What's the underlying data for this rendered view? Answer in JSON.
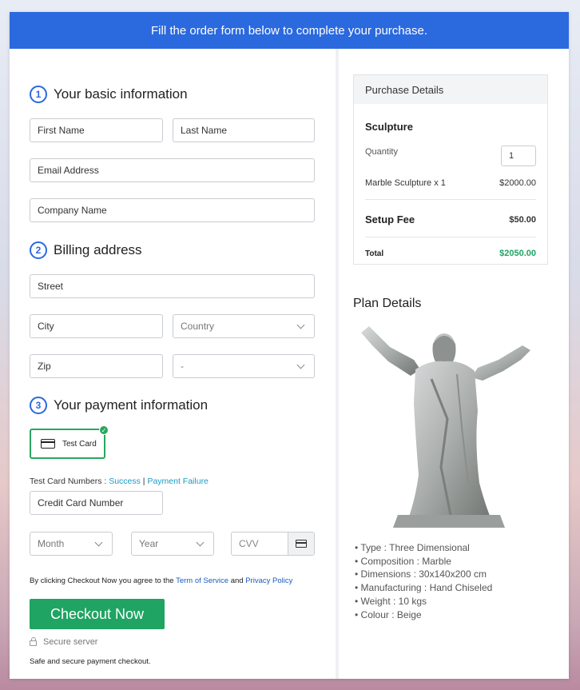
{
  "banner": {
    "text": "Fill the order form below to complete your purchase."
  },
  "basic_info": {
    "step": "1",
    "title": "Your basic information",
    "first_name": "First Name",
    "last_name": "Last Name",
    "email": "Email Address",
    "company": "Company Name"
  },
  "billing": {
    "step": "2",
    "title": "Billing address",
    "street": "Street",
    "city": "City",
    "country": "Country",
    "zip": "Zip",
    "state": "-"
  },
  "payment": {
    "step": "3",
    "title": "Your payment information",
    "card_option": "Test Card",
    "test_numbers_label": "Test Card Numbers : ",
    "success_link": "Success",
    "separator": " | ",
    "failure_link": "Payment Failure",
    "card_number": "Credit Card Number",
    "month": "Month",
    "year": "Year",
    "cvv": "CVV"
  },
  "agreement": {
    "prefix": "By clicking Checkout Now you agree to the ",
    "terms": "Term of Service",
    "and": " and ",
    "privacy": "Privacy Policy"
  },
  "checkout": {
    "button": "Checkout Now",
    "secure": "Secure server",
    "note": "Safe and secure payment checkout."
  },
  "purchase": {
    "header": "Purchase Details",
    "product": "Sculpture",
    "quantity_label": "Quantity",
    "quantity": "1",
    "item": "Marble Sculpture x 1",
    "item_price": "$2000.00",
    "setup_label": "Setup Fee",
    "setup_price": "$50.00",
    "total_label": "Total",
    "total_price": "$2050.00"
  },
  "plan": {
    "title": "Plan Details",
    "features": [
      "Type : Three Dimensional",
      "Composition : Marble",
      "Dimensions : 30x140x200 cm",
      "Manufacturing : Hand Chiseled",
      "Weight : 10 kgs",
      "Colour : Beige"
    ]
  },
  "colors": {
    "banner": "#2b69de",
    "accent_green": "#1fa463",
    "total_green": "#1fa463",
    "link": "#1a9bc4"
  }
}
